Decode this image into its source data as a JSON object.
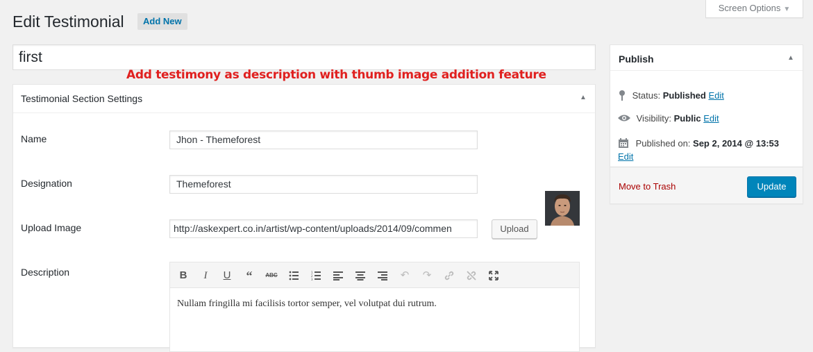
{
  "header": {
    "title": "Edit Testimonial",
    "add_new_label": "Add New",
    "screen_options_label": "Screen Options"
  },
  "post": {
    "title_value": "first"
  },
  "annotation": {
    "text": "Add testimony as description with thumb image addition feature",
    "color": "#e0201f"
  },
  "settings_box": {
    "title": "Testimonial Section Settings",
    "fields": {
      "name_label": "Name",
      "name_value": "Jhon - Themeforest",
      "designation_label": "Designation",
      "designation_value": "Themeforest",
      "upload_label": "Upload Image",
      "upload_value": "http://askexpert.co.in/artist/wp-content/uploads/2014/09/commen",
      "upload_button_label": "Upload",
      "description_label": "Description"
    },
    "editor": {
      "toolbar_icons": [
        "bold-icon",
        "italic-icon",
        "underline-icon",
        "blockquote-icon",
        "strikethrough-icon",
        "bullet-list-icon",
        "numbered-list-icon",
        "align-left-icon",
        "align-center-icon",
        "align-right-icon",
        "undo-icon",
        "redo-icon",
        "insert-link-icon",
        "remove-link-icon",
        "fullscreen-icon"
      ],
      "content": "Nullam fringilla mi facilisis tortor semper, vel volutpat dui rutrum."
    }
  },
  "publish_box": {
    "title": "Publish",
    "status_label": "Status:",
    "status_value": "Published",
    "visibility_label": "Visibility:",
    "visibility_value": "Public",
    "published_on_label": "Published on:",
    "published_on_value": "Sep 2, 2014 @ 13:53",
    "edit_label": "Edit",
    "trash_label": "Move to Trash",
    "update_label": "Update"
  },
  "colors": {
    "link": "#0073aa",
    "primary_button": "#0085ba",
    "trash": "#a00",
    "background": "#f1f1f1"
  }
}
